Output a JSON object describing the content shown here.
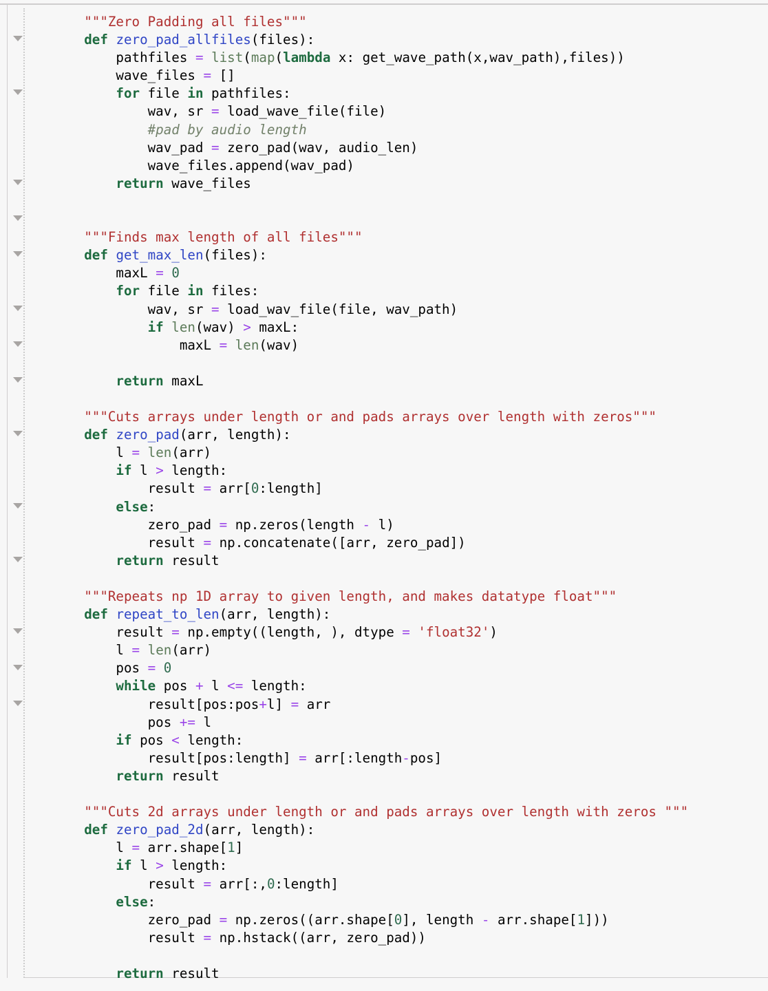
{
  "app": {
    "kind": "jupyter-notebook-code-cell",
    "language": "python"
  },
  "colors": {
    "background": "#f7f7f7",
    "border": "#cfcdce",
    "keyword": "#1d6b3f",
    "function_name": "#2f45c5",
    "builtin": "#5b7a58",
    "operator": "#9a44e8",
    "number": "#2f6b4f",
    "string": "#b03030",
    "comment": "#72816a",
    "plain": "#000000",
    "fold_triangle": "#a8a5a3"
  },
  "gutter": {
    "fold_triangle_lines": [
      1,
      4,
      9,
      11,
      13,
      16,
      18,
      20,
      23,
      27,
      30,
      34,
      36,
      38
    ]
  },
  "cell": {
    "lines": [
      [
        {
          "t": "    ",
          "c": "pl"
        },
        {
          "t": "\"\"\"Zero Padding all files\"\"\"",
          "c": "str"
        }
      ],
      [
        {
          "t": "    ",
          "c": "pl"
        },
        {
          "t": "def",
          "c": "k"
        },
        {
          "t": " ",
          "c": "pl"
        },
        {
          "t": "zero_pad_allfiles",
          "c": "fn"
        },
        {
          "t": "(files):",
          "c": "pl"
        }
      ],
      [
        {
          "t": "        pathfiles ",
          "c": "pl"
        },
        {
          "t": "=",
          "c": "op"
        },
        {
          "t": " ",
          "c": "pl"
        },
        {
          "t": "list",
          "c": "bi"
        },
        {
          "t": "(",
          "c": "pl"
        },
        {
          "t": "map",
          "c": "bi"
        },
        {
          "t": "(",
          "c": "pl"
        },
        {
          "t": "lambda",
          "c": "k"
        },
        {
          "t": " x: get_wave_path(x,wav_path),files))",
          "c": "pl"
        }
      ],
      [
        {
          "t": "        wave_files ",
          "c": "pl"
        },
        {
          "t": "=",
          "c": "op"
        },
        {
          "t": " []",
          "c": "pl"
        }
      ],
      [
        {
          "t": "        ",
          "c": "pl"
        },
        {
          "t": "for",
          "c": "k"
        },
        {
          "t": " file ",
          "c": "pl"
        },
        {
          "t": "in",
          "c": "k"
        },
        {
          "t": " pathfiles:",
          "c": "pl"
        }
      ],
      [
        {
          "t": "            wav, sr ",
          "c": "pl"
        },
        {
          "t": "=",
          "c": "op"
        },
        {
          "t": " load_wave_file(file)",
          "c": "pl"
        }
      ],
      [
        {
          "t": "            ",
          "c": "pl"
        },
        {
          "t": "#pad by audio length",
          "c": "cm"
        }
      ],
      [
        {
          "t": "            wav_pad ",
          "c": "pl"
        },
        {
          "t": "=",
          "c": "op"
        },
        {
          "t": " zero_pad(wav, audio_len)",
          "c": "pl"
        }
      ],
      [
        {
          "t": "            wave_files.append(wav_pad)",
          "c": "pl"
        }
      ],
      [
        {
          "t": "        ",
          "c": "pl"
        },
        {
          "t": "return",
          "c": "k"
        },
        {
          "t": " wave_files",
          "c": "pl"
        }
      ],
      [
        {
          "t": "",
          "c": "pl"
        }
      ],
      [
        {
          "t": "",
          "c": "pl"
        }
      ],
      [
        {
          "t": "    ",
          "c": "pl"
        },
        {
          "t": "\"\"\"Finds max length of all files\"\"\"",
          "c": "str"
        }
      ],
      [
        {
          "t": "    ",
          "c": "pl"
        },
        {
          "t": "def",
          "c": "k"
        },
        {
          "t": " ",
          "c": "pl"
        },
        {
          "t": "get_max_len",
          "c": "fn"
        },
        {
          "t": "(files):",
          "c": "pl"
        }
      ],
      [
        {
          "t": "        maxL ",
          "c": "pl"
        },
        {
          "t": "=",
          "c": "op"
        },
        {
          "t": " ",
          "c": "pl"
        },
        {
          "t": "0",
          "c": "num"
        }
      ],
      [
        {
          "t": "        ",
          "c": "pl"
        },
        {
          "t": "for",
          "c": "k"
        },
        {
          "t": " file ",
          "c": "pl"
        },
        {
          "t": "in",
          "c": "k"
        },
        {
          "t": " files:",
          "c": "pl"
        }
      ],
      [
        {
          "t": "            wav, sr ",
          "c": "pl"
        },
        {
          "t": "=",
          "c": "op"
        },
        {
          "t": " load_wav_file(file, wav_path)",
          "c": "pl"
        }
      ],
      [
        {
          "t": "            ",
          "c": "pl"
        },
        {
          "t": "if",
          "c": "k"
        },
        {
          "t": " ",
          "c": "pl"
        },
        {
          "t": "len",
          "c": "bi"
        },
        {
          "t": "(wav) ",
          "c": "pl"
        },
        {
          "t": ">",
          "c": "op"
        },
        {
          "t": " maxL:",
          "c": "pl"
        }
      ],
      [
        {
          "t": "                maxL ",
          "c": "pl"
        },
        {
          "t": "=",
          "c": "op"
        },
        {
          "t": " ",
          "c": "pl"
        },
        {
          "t": "len",
          "c": "bi"
        },
        {
          "t": "(wav)",
          "c": "pl"
        }
      ],
      [
        {
          "t": "",
          "c": "pl"
        }
      ],
      [
        {
          "t": "        ",
          "c": "pl"
        },
        {
          "t": "return",
          "c": "k"
        },
        {
          "t": " maxL",
          "c": "pl"
        }
      ],
      [
        {
          "t": "",
          "c": "pl"
        }
      ],
      [
        {
          "t": "    ",
          "c": "pl"
        },
        {
          "t": "\"\"\"Cuts arrays under length or and pads arrays over length with zeros\"\"\"",
          "c": "str"
        }
      ],
      [
        {
          "t": "    ",
          "c": "pl"
        },
        {
          "t": "def",
          "c": "k"
        },
        {
          "t": " ",
          "c": "pl"
        },
        {
          "t": "zero_pad",
          "c": "fn"
        },
        {
          "t": "(arr, length):",
          "c": "pl"
        }
      ],
      [
        {
          "t": "        l ",
          "c": "pl"
        },
        {
          "t": "=",
          "c": "op"
        },
        {
          "t": " ",
          "c": "pl"
        },
        {
          "t": "len",
          "c": "bi"
        },
        {
          "t": "(arr)",
          "c": "pl"
        }
      ],
      [
        {
          "t": "        ",
          "c": "pl"
        },
        {
          "t": "if",
          "c": "k"
        },
        {
          "t": " l ",
          "c": "pl"
        },
        {
          "t": ">",
          "c": "op"
        },
        {
          "t": " length:",
          "c": "pl"
        }
      ],
      [
        {
          "t": "            result ",
          "c": "pl"
        },
        {
          "t": "=",
          "c": "op"
        },
        {
          "t": " arr[",
          "c": "pl"
        },
        {
          "t": "0",
          "c": "num"
        },
        {
          "t": ":length]",
          "c": "pl"
        }
      ],
      [
        {
          "t": "        ",
          "c": "pl"
        },
        {
          "t": "else",
          "c": "k"
        },
        {
          "t": ":",
          "c": "pl"
        }
      ],
      [
        {
          "t": "            zero_pad ",
          "c": "pl"
        },
        {
          "t": "=",
          "c": "op"
        },
        {
          "t": " np.zeros(length ",
          "c": "pl"
        },
        {
          "t": "-",
          "c": "op"
        },
        {
          "t": " l)",
          "c": "pl"
        }
      ],
      [
        {
          "t": "            result ",
          "c": "pl"
        },
        {
          "t": "=",
          "c": "op"
        },
        {
          "t": " np.concatenate([arr, zero_pad])",
          "c": "pl"
        }
      ],
      [
        {
          "t": "        ",
          "c": "pl"
        },
        {
          "t": "return",
          "c": "k"
        },
        {
          "t": " result",
          "c": "pl"
        }
      ],
      [
        {
          "t": "",
          "c": "pl"
        }
      ],
      [
        {
          "t": "    ",
          "c": "pl"
        },
        {
          "t": "\"\"\"Repeats np 1D array to given length, and makes datatype float\"\"\"",
          "c": "str"
        }
      ],
      [
        {
          "t": "    ",
          "c": "pl"
        },
        {
          "t": "def",
          "c": "k"
        },
        {
          "t": " ",
          "c": "pl"
        },
        {
          "t": "repeat_to_len",
          "c": "fn"
        },
        {
          "t": "(arr, length):",
          "c": "pl"
        }
      ],
      [
        {
          "t": "        result ",
          "c": "pl"
        },
        {
          "t": "=",
          "c": "op"
        },
        {
          "t": " np.empty((length, ), dtype ",
          "c": "pl"
        },
        {
          "t": "=",
          "c": "op"
        },
        {
          "t": " ",
          "c": "pl"
        },
        {
          "t": "'float32'",
          "c": "str"
        },
        {
          "t": ")",
          "c": "pl"
        }
      ],
      [
        {
          "t": "        l ",
          "c": "pl"
        },
        {
          "t": "=",
          "c": "op"
        },
        {
          "t": " ",
          "c": "pl"
        },
        {
          "t": "len",
          "c": "bi"
        },
        {
          "t": "(arr)",
          "c": "pl"
        }
      ],
      [
        {
          "t": "        pos ",
          "c": "pl"
        },
        {
          "t": "=",
          "c": "op"
        },
        {
          "t": " ",
          "c": "pl"
        },
        {
          "t": "0",
          "c": "num"
        }
      ],
      [
        {
          "t": "        ",
          "c": "pl"
        },
        {
          "t": "while",
          "c": "k"
        },
        {
          "t": " pos ",
          "c": "pl"
        },
        {
          "t": "+",
          "c": "op"
        },
        {
          "t": " l ",
          "c": "pl"
        },
        {
          "t": "<=",
          "c": "op"
        },
        {
          "t": " length:",
          "c": "pl"
        }
      ],
      [
        {
          "t": "            result[pos:pos",
          "c": "pl"
        },
        {
          "t": "+",
          "c": "op"
        },
        {
          "t": "l] ",
          "c": "pl"
        },
        {
          "t": "=",
          "c": "op"
        },
        {
          "t": " arr",
          "c": "pl"
        }
      ],
      [
        {
          "t": "            pos ",
          "c": "pl"
        },
        {
          "t": "+=",
          "c": "op"
        },
        {
          "t": " l",
          "c": "pl"
        }
      ],
      [
        {
          "t": "        ",
          "c": "pl"
        },
        {
          "t": "if",
          "c": "k"
        },
        {
          "t": " pos ",
          "c": "pl"
        },
        {
          "t": "<",
          "c": "op"
        },
        {
          "t": " length:",
          "c": "pl"
        }
      ],
      [
        {
          "t": "            result[pos:length] ",
          "c": "pl"
        },
        {
          "t": "=",
          "c": "op"
        },
        {
          "t": " arr[:length",
          "c": "pl"
        },
        {
          "t": "-",
          "c": "op"
        },
        {
          "t": "pos]",
          "c": "pl"
        }
      ],
      [
        {
          "t": "        ",
          "c": "pl"
        },
        {
          "t": "return",
          "c": "k"
        },
        {
          "t": " result",
          "c": "pl"
        }
      ],
      [
        {
          "t": "",
          "c": "pl"
        }
      ],
      [
        {
          "t": "    ",
          "c": "pl"
        },
        {
          "t": "\"\"\"Cuts 2d arrays under length or and pads arrays over length with zeros \"\"\"",
          "c": "str"
        }
      ],
      [
        {
          "t": "    ",
          "c": "pl"
        },
        {
          "t": "def",
          "c": "k"
        },
        {
          "t": " ",
          "c": "pl"
        },
        {
          "t": "zero_pad_2d",
          "c": "fn"
        },
        {
          "t": "(arr, length):",
          "c": "pl"
        }
      ],
      [
        {
          "t": "        l ",
          "c": "pl"
        },
        {
          "t": "=",
          "c": "op"
        },
        {
          "t": " arr.shape[",
          "c": "pl"
        },
        {
          "t": "1",
          "c": "num"
        },
        {
          "t": "]",
          "c": "pl"
        }
      ],
      [
        {
          "t": "        ",
          "c": "pl"
        },
        {
          "t": "if",
          "c": "k"
        },
        {
          "t": " l ",
          "c": "pl"
        },
        {
          "t": ">",
          "c": "op"
        },
        {
          "t": " length:",
          "c": "pl"
        }
      ],
      [
        {
          "t": "            result ",
          "c": "pl"
        },
        {
          "t": "=",
          "c": "op"
        },
        {
          "t": " arr[:,",
          "c": "pl"
        },
        {
          "t": "0",
          "c": "num"
        },
        {
          "t": ":length]",
          "c": "pl"
        }
      ],
      [
        {
          "t": "        ",
          "c": "pl"
        },
        {
          "t": "else",
          "c": "k"
        },
        {
          "t": ":",
          "c": "pl"
        }
      ],
      [
        {
          "t": "            zero_pad ",
          "c": "pl"
        },
        {
          "t": "=",
          "c": "op"
        },
        {
          "t": " np.zeros((arr.shape[",
          "c": "pl"
        },
        {
          "t": "0",
          "c": "num"
        },
        {
          "t": "], length ",
          "c": "pl"
        },
        {
          "t": "-",
          "c": "op"
        },
        {
          "t": " arr.shape[",
          "c": "pl"
        },
        {
          "t": "1",
          "c": "num"
        },
        {
          "t": "]))",
          "c": "pl"
        }
      ],
      [
        {
          "t": "            result ",
          "c": "pl"
        },
        {
          "t": "=",
          "c": "op"
        },
        {
          "t": " np.hstack((arr, zero_pad))",
          "c": "pl"
        }
      ],
      [
        {
          "t": "",
          "c": "pl"
        }
      ],
      [
        {
          "t": "        ",
          "c": "pl"
        },
        {
          "t": "return",
          "c": "k"
        },
        {
          "t": " result",
          "c": "pl"
        }
      ]
    ]
  }
}
